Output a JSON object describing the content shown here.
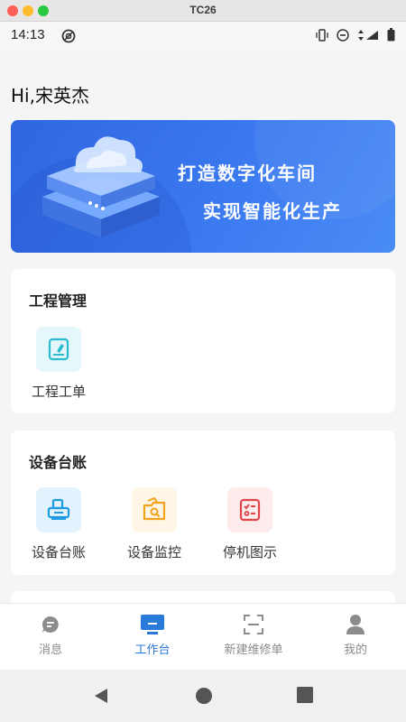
{
  "window": {
    "title": "TC26"
  },
  "status_bar": {
    "time": "14:13"
  },
  "greeting": "Hi,宋英杰",
  "banner": {
    "line1": "打造数字化车间",
    "line2": "实现智能化生产"
  },
  "engineering_card": {
    "title": "工程管理",
    "items": [
      {
        "label": "工程工单",
        "icon": "document-edit-icon"
      }
    ]
  },
  "equipment_card": {
    "title": "设备台账",
    "items": [
      {
        "label": "设备台账",
        "icon": "printer-icon"
      },
      {
        "label": "设备监控",
        "icon": "folder-search-icon"
      },
      {
        "label": "停机图示",
        "icon": "checklist-icon"
      }
    ]
  },
  "tabbar": {
    "items": [
      {
        "label": "消息",
        "icon": "chat-icon"
      },
      {
        "label": "工作台",
        "icon": "monitor-icon",
        "active": true
      },
      {
        "label": "新建维修单",
        "icon": "scan-icon"
      },
      {
        "label": "我的",
        "icon": "user-icon"
      }
    ]
  },
  "colors": {
    "accent": "#2a7ad9",
    "banner": "#3b79f0"
  }
}
